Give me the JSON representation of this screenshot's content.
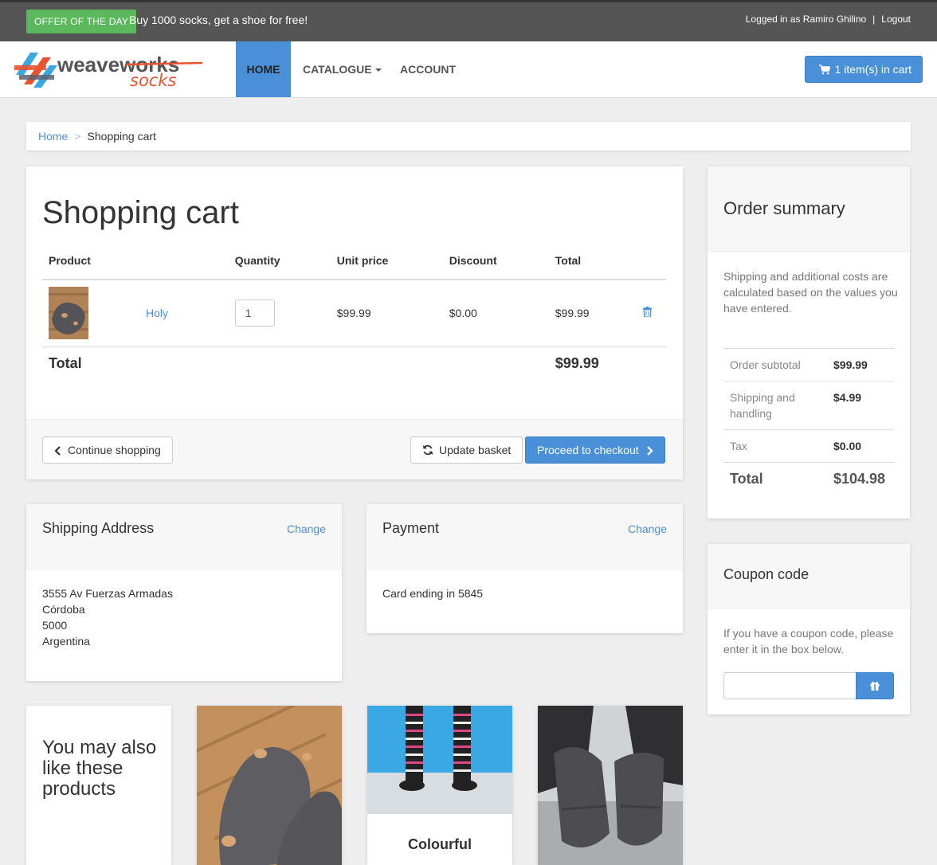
{
  "topbar": {
    "offer_label": "OFFER OF THE DAY",
    "offer_text": "Buy 1000 socks, get a shoe for free!",
    "logged_in": "Logged in as Ramiro Ghilino",
    "separator": "|",
    "logout": "Logout"
  },
  "nav": {
    "brand_main": "weaveworks",
    "brand_sub": "socks",
    "home": "HOME",
    "catalogue": "CATALOGUE",
    "account": "ACCOUNT",
    "cart_button": "1 item(s) in cart"
  },
  "breadcrumb": {
    "home": "Home",
    "separator": ">",
    "current": "Shopping cart"
  },
  "cart": {
    "title": "Shopping cart",
    "headers": {
      "product": "Product",
      "quantity": "Quantity",
      "unit_price": "Unit price",
      "discount": "Discount",
      "total": "Total"
    },
    "items": [
      {
        "name": "Holy",
        "quantity": "1",
        "unit_price": "$99.99",
        "discount": "$0.00",
        "total": "$99.99"
      }
    ],
    "total_label": "Total",
    "total_value": "$99.99",
    "continue_shopping": "Continue shopping",
    "update_basket": "Update basket",
    "checkout": "Proceed to checkout"
  },
  "summary": {
    "title": "Order summary",
    "note": "Shipping and additional costs are calculated based on the values you have entered.",
    "rows": [
      {
        "label": "Order subtotal",
        "value": "$99.99"
      },
      {
        "label": "Shipping and handling",
        "value": "$4.99"
      },
      {
        "label": "Tax",
        "value": "$0.00"
      }
    ],
    "total_label": "Total",
    "total_value": "$104.98"
  },
  "coupon": {
    "title": "Coupon code",
    "note": "If you have a coupon code, please enter it in the box below.",
    "value": ""
  },
  "shipping": {
    "title": "Shipping Address",
    "change": "Change",
    "lines": [
      "3555 Av Fuerzas Armadas",
      "Córdoba",
      "5000",
      "Argentina"
    ]
  },
  "payment": {
    "title": "Payment",
    "change": "Change",
    "card": "Card ending in 5845"
  },
  "related": {
    "title": "You may also like these products",
    "products": [
      {
        "caption": ""
      },
      {
        "caption": "Colourful"
      },
      {
        "caption": ""
      }
    ]
  },
  "colors": {
    "accent": "#4a90d9",
    "offer": "#5cb85c",
    "topbar": "#555555",
    "brand_orange": "#e8542f"
  },
  "icons": {
    "cart": "shopping-cart-icon",
    "trash": "trash-icon",
    "refresh": "refresh-icon",
    "chevron_left": "chevron-left-icon",
    "chevron_right": "chevron-right-icon",
    "gift": "gift-icon"
  }
}
